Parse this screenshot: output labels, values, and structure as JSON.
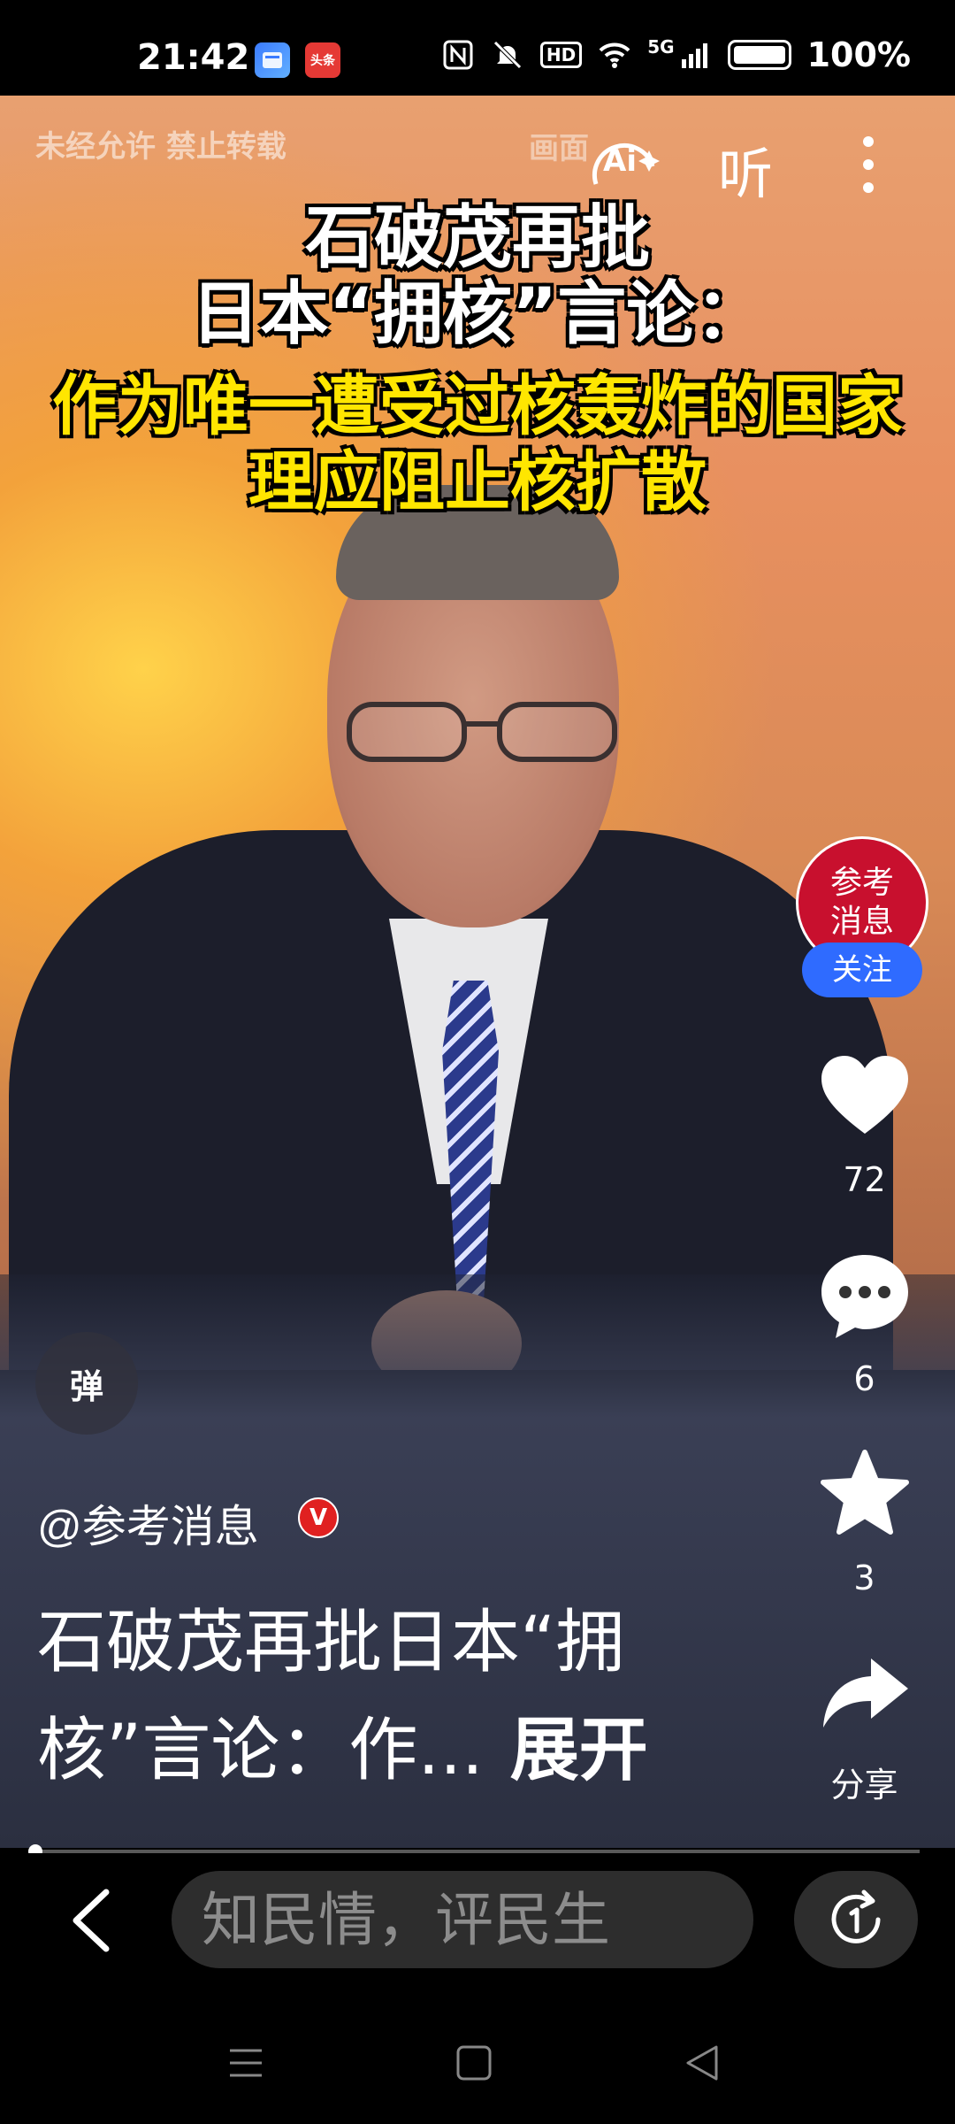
{
  "status_bar": {
    "time": "21:42",
    "app_icon_2_text": "头条",
    "network": "5G",
    "hd_label": "HD",
    "battery_percent": "100%"
  },
  "video": {
    "watermark_left": "未经允许 禁止转载",
    "watermark_right": "画面",
    "ai_label": "Ai",
    "listen_label": "听",
    "headline": {
      "line1": "石破茂再批",
      "line2": "日本“拥核”言论：",
      "line3": "作为唯一遭受过核轰炸的国家",
      "line4": "理应阻止核扩散"
    },
    "danmu_label": "弹"
  },
  "side_actions": {
    "avatar_text": "参考消息",
    "follow_label": "关注",
    "like_count": "72",
    "comment_count": "6",
    "favorite_count": "3",
    "share_label": "分享"
  },
  "post": {
    "author": "@参考消息",
    "verified_badge": "V",
    "caption": "石破茂再批日本“拥核”言论：作...",
    "expand_label": "展开",
    "progress": 0.005
  },
  "bottom_bar": {
    "comment_placeholder": "知民情，评民生"
  },
  "colors": {
    "follow_button": "#2f6bff",
    "verified_badge": "#e02020",
    "headline_yellow": "#ffe600",
    "avatar_red": "#c8102e"
  }
}
